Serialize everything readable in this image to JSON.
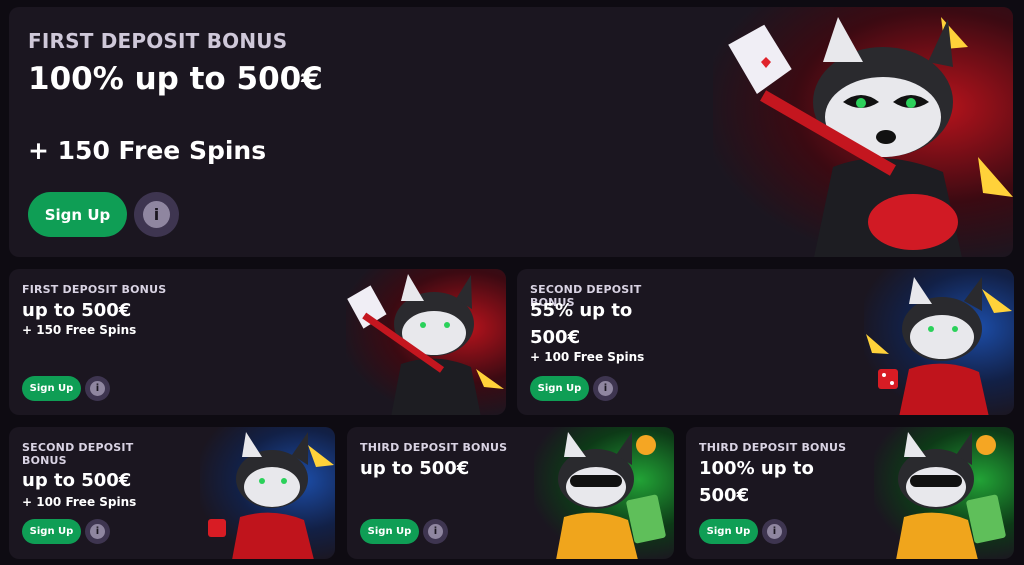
{
  "hero": {
    "eyebrow": "FIRST DEPOSIT BONUS",
    "headline": "100% up to 500€",
    "sub": "+ 150 Free Spins",
    "button": "Sign Up",
    "info": "i"
  },
  "cards": [
    {
      "eyebrow": "FIRST DEPOSIT BONUS",
      "headline": "up to 500€",
      "sub": "+ 150 Free Spins",
      "button": "Sign Up",
      "info": "i",
      "theme": "#b8131c"
    },
    {
      "eyebrow": "SECOND DEPOSIT BONUS",
      "headline": "55% up to 500€",
      "sub": "+ 100 Free Spins",
      "button": "Sign Up",
      "info": "i",
      "theme": "#1c4da8"
    },
    {
      "eyebrow": "SECOND DEPOSIT BONUS",
      "headline": "up to 500€",
      "sub": "+ 100 Free Spins",
      "button": "Sign Up",
      "info": "i",
      "theme": "#1c4da8"
    },
    {
      "eyebrow": "THIRD DEPOSIT BONUS",
      "headline": "up to 500€",
      "sub": "",
      "button": "Sign Up",
      "info": "i",
      "theme": "#22a336"
    },
    {
      "eyebrow": "THIRD DEPOSIT BONUS",
      "headline": "100% up to 500€",
      "sub": "",
      "button": "Sign Up",
      "info": "i",
      "theme": "#22a336"
    }
  ],
  "colors": {
    "background": "#0e0b12",
    "card": "#1b1620",
    "button": "#0f9e55",
    "info_bg": "#3e3550"
  },
  "icons": {
    "info": "info-icon",
    "mascot": "raccoon-mascot-illustration"
  }
}
